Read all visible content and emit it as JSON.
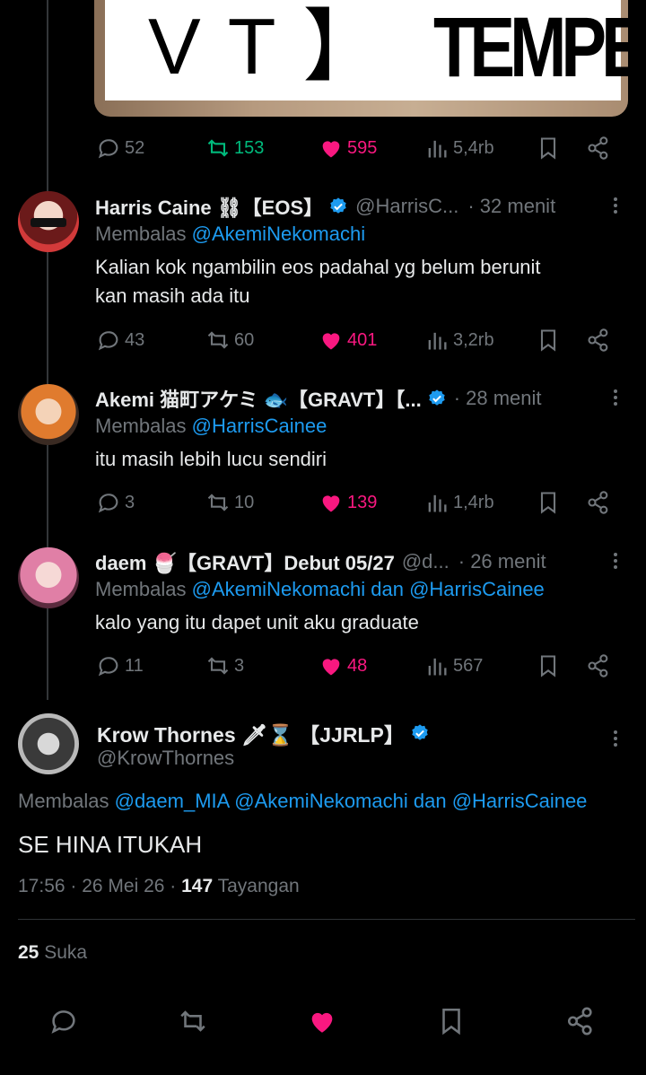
{
  "media": {
    "text_left": "VT】",
    "text_right": "TEMPE.CO"
  },
  "top_stats": {
    "replies": "52",
    "retweets": "153",
    "likes": "595",
    "views": "5,4rb"
  },
  "replies": [
    {
      "name": "Harris Caine ⛓【EOS】",
      "handle": "@HarrisC...",
      "time": "· 32 menit",
      "replying_prefix": "Membalas",
      "replying_to": "@AkemiNekomachi",
      "replying_rest": "",
      "text_line1": "Kalian kok ngambilin eos padahal yg belum berunit",
      "text_line2": "kan masih ada itu",
      "stats": {
        "replies": "43",
        "retweets": "60",
        "likes": "401",
        "views": "3,2rb"
      }
    },
    {
      "name": "Akemi 猫町アケミ 🐟【GRAVT】【...",
      "handle": "",
      "time": "· 28 menit",
      "replying_prefix": "Membalas",
      "replying_to": "@HarrisCainee",
      "replying_rest": "",
      "text_line1": "itu masih lebih lucu sendiri",
      "text_line2": "",
      "stats": {
        "replies": "3",
        "retweets": "10",
        "likes": "139",
        "views": "1,4rb"
      }
    },
    {
      "name": "daem 🍧【GRAVT】Debut 05/27",
      "handle": "@d...",
      "time": "· 26 menit",
      "replying_prefix": "Membalas",
      "replying_to": "@AkemiNekomachi",
      "replying_mid": "dan",
      "replying_to2": "@HarrisCainee",
      "text_line1": "kalo yang itu dapet unit aku graduate",
      "text_line2": "",
      "stats": {
        "replies": "11",
        "retweets": "3",
        "likes": "48",
        "views": "567"
      }
    }
  ],
  "focused": {
    "name": "Krow Thornes 🗡⌛ 【JJRLP】",
    "handle": "@KrowThornes",
    "replying_prefix": "Membalas",
    "mention1": "@daem_MIA",
    "mention2": "@AkemiNekomachi",
    "replying_mid": "dan",
    "mention3": "@HarrisCainee",
    "text": "SE HINA ITUKAH",
    "meta_time": "17:56 · 26 Mei 26 ·",
    "views_count": "147",
    "views_label": "Tayangan",
    "likes_count": "25",
    "likes_label": "Suka"
  },
  "colors": {
    "link": "#1d9bf0",
    "like": "#f91880",
    "retweet": "#00ba7c",
    "muted": "#71767b"
  }
}
